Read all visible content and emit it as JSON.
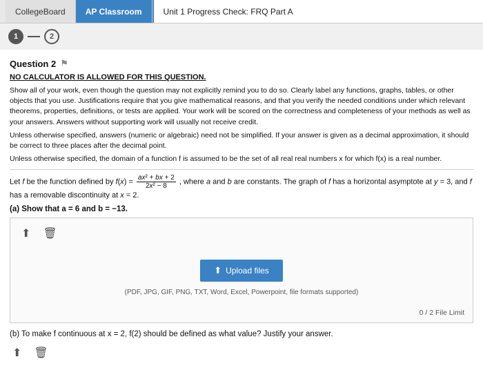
{
  "topbar": {
    "tab_collegeboard": "CollegeBoard",
    "tab_ap": "AP Classroom",
    "tab_title": "Unit 1 Progress Check: FRQ Part A"
  },
  "steps": {
    "step1": "1",
    "step2": "2"
  },
  "question": {
    "number": "Question 2",
    "no_calc": "NO CALCULATOR IS ALLOWED FOR THIS QUESTION.",
    "instruction1": "Show all of your work, even though the question may not explicitly remind you to do so. Clearly label any functions, graphs, tables, or other objects that you use. Justifications require that you give mathematical reasons, and that you verify the needed conditions under which relevant theorems, properties, definitions, or tests are applied. Your work will be scored on the correctness and completeness of your methods as well as your answers. Answers without supporting work will usually not receive credit.",
    "instruction2": "Unless otherwise specified, answers (numeric or algebraic) need not be simplified. If your answer is given as a decimal approximation, it should be correct to three places after the decimal point.",
    "instruction3": "Unless otherwise specified, the domain of a function f is assumed to be the set of all real real numbers x for which f(x) is a real number.",
    "function_def": "Let f be the function defined by f(x) = (ax² + bx + 2) / (2x² - 8), where a and b are constants. The graph of f has a horizontal asymptote at y = 3, and f has a removable discontinuity at x = 2.",
    "part_a_label": "(a) Show that a = 6 and b = −13.",
    "upload": {
      "button_label": "Upload files",
      "file_formats": "(PDF, JPG, GIF, PNG, TXT, Word, Excel, Powerpoint, file formats supported)",
      "file_limit": "0 / 2 File Limit"
    },
    "part_b_label": "(b) To make f continuous at x = 2, f(2) should be defined as what value? Justify your answer."
  },
  "icons": {
    "upload_arrow": "⬆",
    "flag": "⚑",
    "upload_icon": "⬆",
    "trash_icon": "🗑",
    "upload_icon2": "⬆",
    "trash_icon2": "🗑"
  }
}
